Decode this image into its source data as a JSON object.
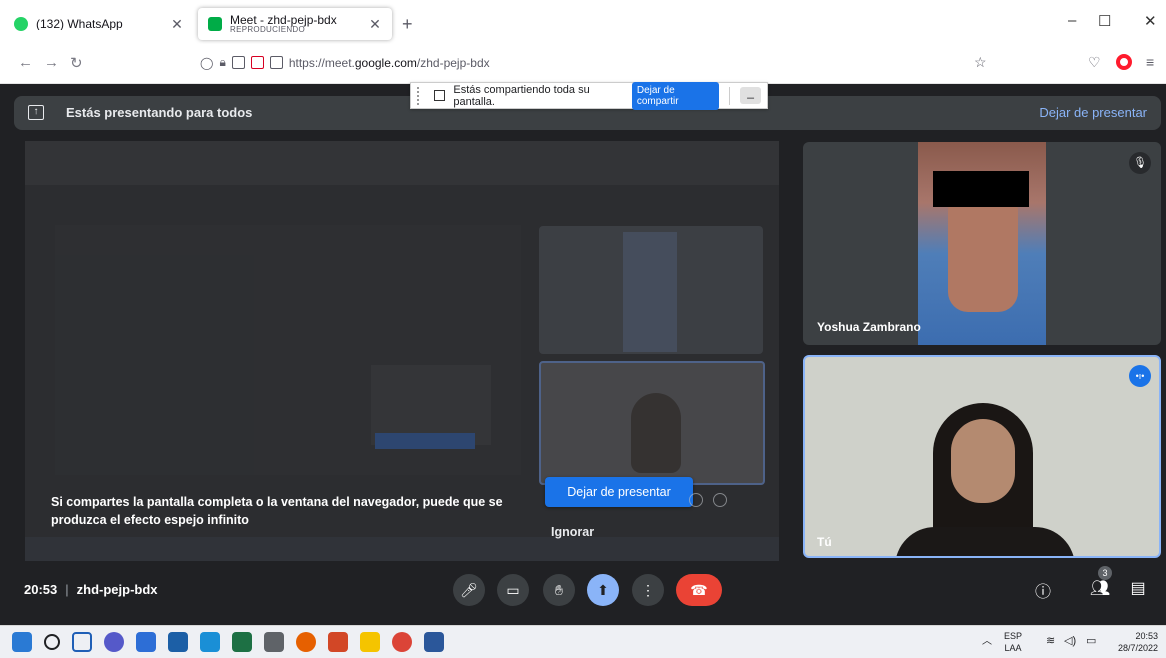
{
  "browser": {
    "tabs": [
      {
        "title": "(132) WhatsApp",
        "subtitle": "",
        "active": false
      },
      {
        "title": "Meet - zhd-pejp-bdx",
        "subtitle": "REPRODUCIENDO",
        "active": true
      }
    ],
    "new_tab": "+",
    "url_prefix": "https://meet.",
    "url_domain": "google.com",
    "url_path": "/zhd-pejp-bdx",
    "window_controls": [
      "–",
      "☐",
      "✕"
    ]
  },
  "share_bar": {
    "message": "Estás compartiendo toda su pantalla.",
    "stop_label": "Dejar de compartir",
    "minimize_label": "_"
  },
  "banner": {
    "text": "Estás presentando para todos",
    "stop_label": "Dejar de presentar"
  },
  "presentation": {
    "warning": "Si compartes la pantalla completa o la ventana del navegador, puede que se produzca el efecto espejo infinito",
    "present_button": "Dejar de presentar",
    "ignore_button": "Ignorar"
  },
  "participants": [
    {
      "name": "Yoshua Zambrano",
      "muted": true
    },
    {
      "name": "Tú",
      "speaking": true
    }
  ],
  "footer": {
    "time": "20:53",
    "meeting_code": "zhd-pejp-bdx",
    "people_count": "3"
  },
  "taskbar": {
    "lang": "ESP",
    "layout": "LAA",
    "time": "20:53",
    "date": "28/7/2022"
  },
  "colors": {
    "meet_bg": "#202124",
    "accent_blue": "#1a73e8",
    "end_call_red": "#ea4335",
    "banner_link": "#8ab4f8"
  }
}
